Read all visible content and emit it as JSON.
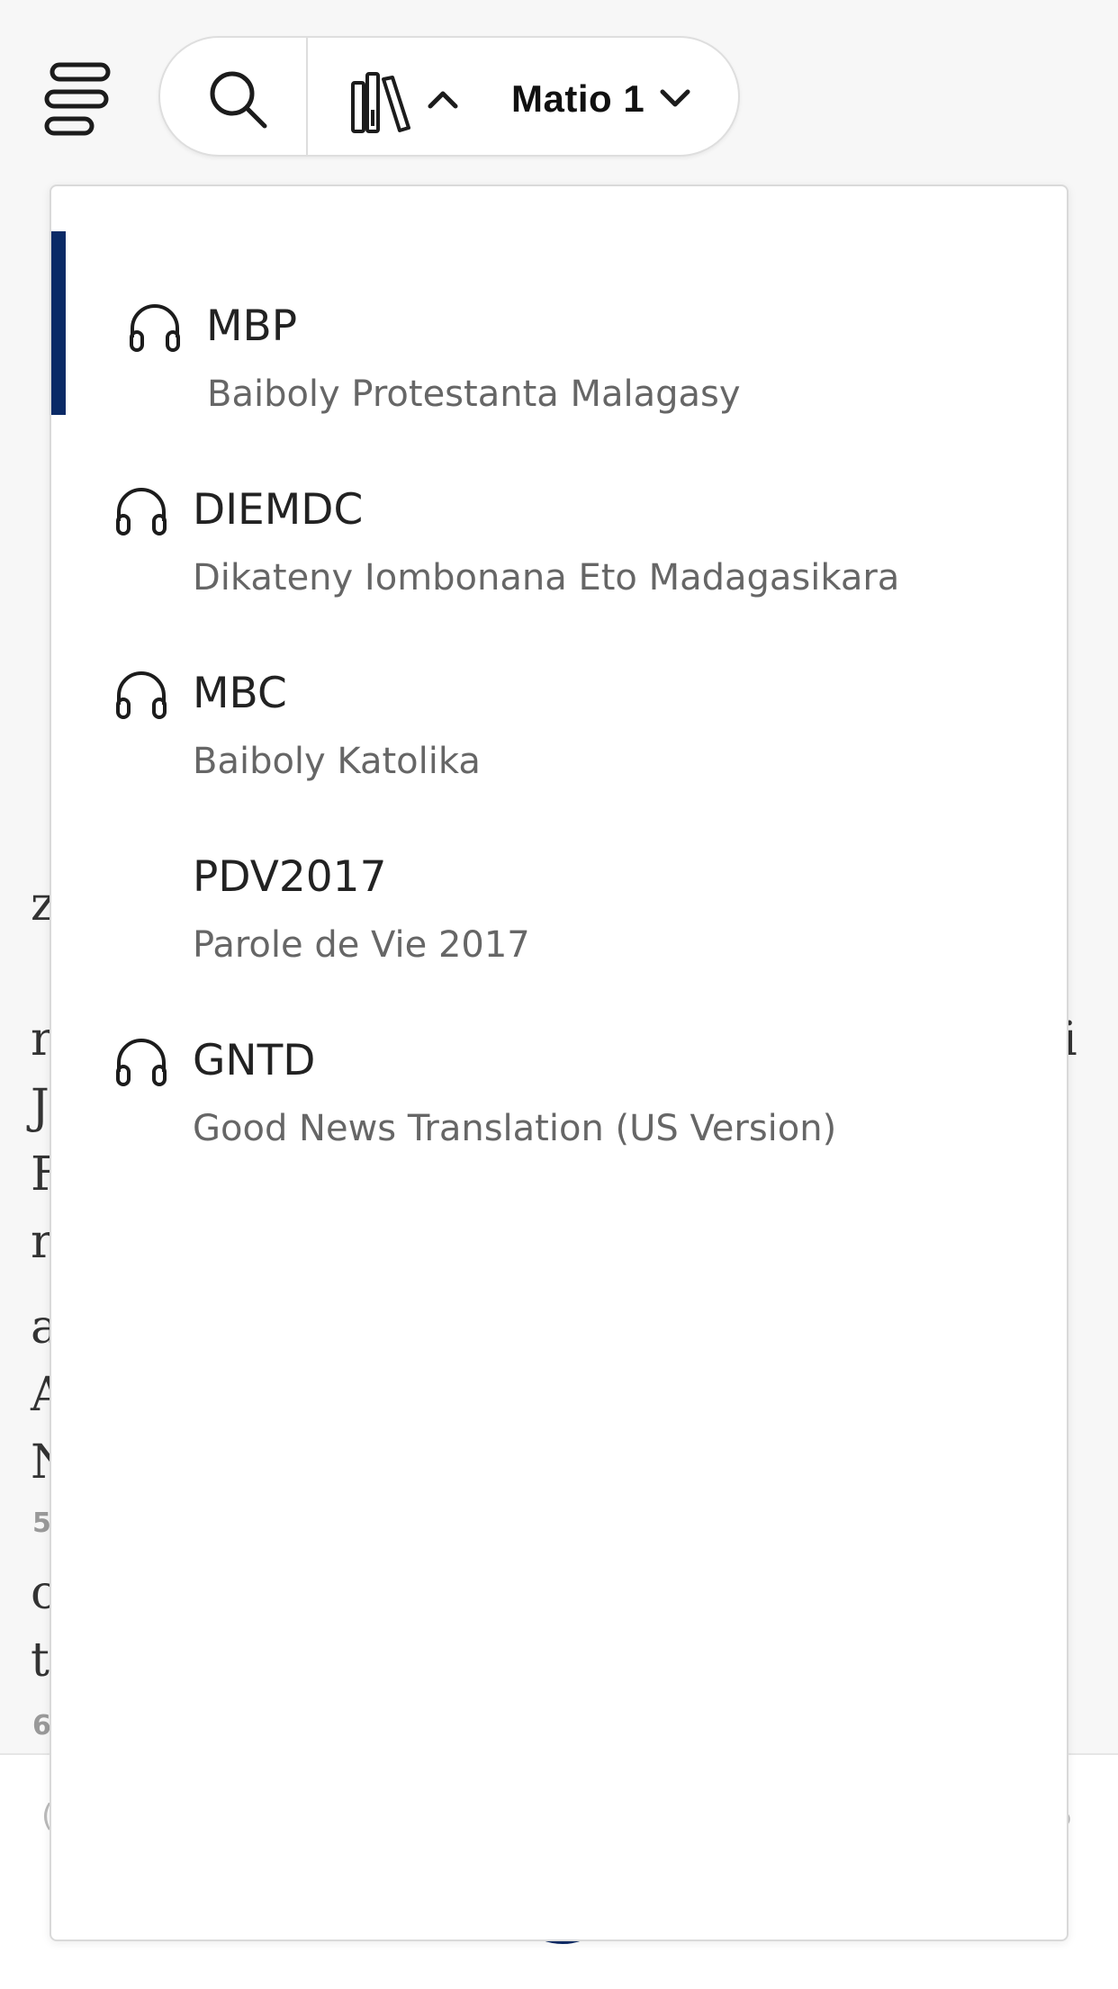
{
  "header": {
    "chapter_label": "Matio 1"
  },
  "background": {
    "fragments": [
      "z",
      "r",
      "J",
      "F",
      "r",
      "a",
      "A",
      "N",
      "c",
      "t",
      "i"
    ],
    "verse_numbers": [
      "5",
      "6"
    ],
    "bottom_fragments": [
      "(",
      "5"
    ]
  },
  "versions": [
    {
      "abbr": "MBP",
      "name": "Baiboly Protestanta Malagasy",
      "audio": true,
      "selected": true
    },
    {
      "abbr": "DIEMDC",
      "name": "Dikateny Iombonana Eto Madagasikara",
      "audio": true,
      "selected": false
    },
    {
      "abbr": "MBC",
      "name": "Baiboly Katolika",
      "audio": true,
      "selected": false
    },
    {
      "abbr": "PDV2017",
      "name": "Parole de Vie 2017",
      "audio": false,
      "selected": false
    },
    {
      "abbr": "GNTD",
      "name": "Good News Translation (US Version)",
      "audio": true,
      "selected": false
    }
  ],
  "colors": {
    "accent": "#0a2a66",
    "panel_bg": "#ffffff",
    "page_bg": "#f7f7f7"
  }
}
